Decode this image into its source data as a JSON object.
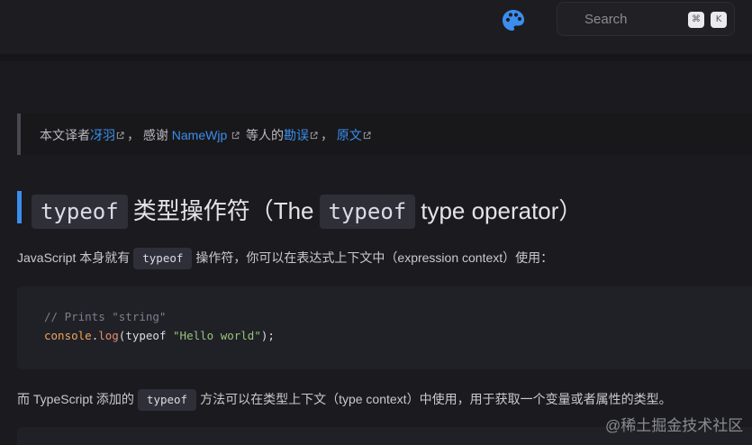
{
  "header": {
    "search_placeholder": "Search",
    "shortcut_keys": [
      "⌘",
      "K"
    ]
  },
  "notice": {
    "prefix": "本文译者",
    "translator": "冴羽",
    "thanks": "， 感谢 ",
    "reviewer": "NameWjp",
    "mid": " 等人的",
    "review_link": "勘误",
    "sep": "， ",
    "original_link": "原文"
  },
  "heading": {
    "code1": "typeof",
    "text1": "类型操作符（The",
    "code2": "typeof",
    "text2": "type operator）"
  },
  "para1": {
    "before": "JavaScript 本身就有",
    "code": "typeof",
    "after": "操作符，你可以在表达式上下文中（expression context）使用："
  },
  "code_block": {
    "comment": "// Prints \"string\"",
    "line2_obj": "console",
    "line2_dot": ".",
    "line2_fn": "log",
    "line2_open": "(",
    "line2_kw": "typeof ",
    "line2_str": "\"Hello world\"",
    "line2_close": ");"
  },
  "para2": {
    "before": "而 TypeScript 添加的",
    "code": "typeof",
    "after": "方法可以在类型上下文（type context）中使用，用于获取一个变量或者属性的类型。"
  },
  "watermark": "@稀土掘金技术社区",
  "colors": {
    "accent": "#3b8eed",
    "background": "#1b1b1f"
  }
}
